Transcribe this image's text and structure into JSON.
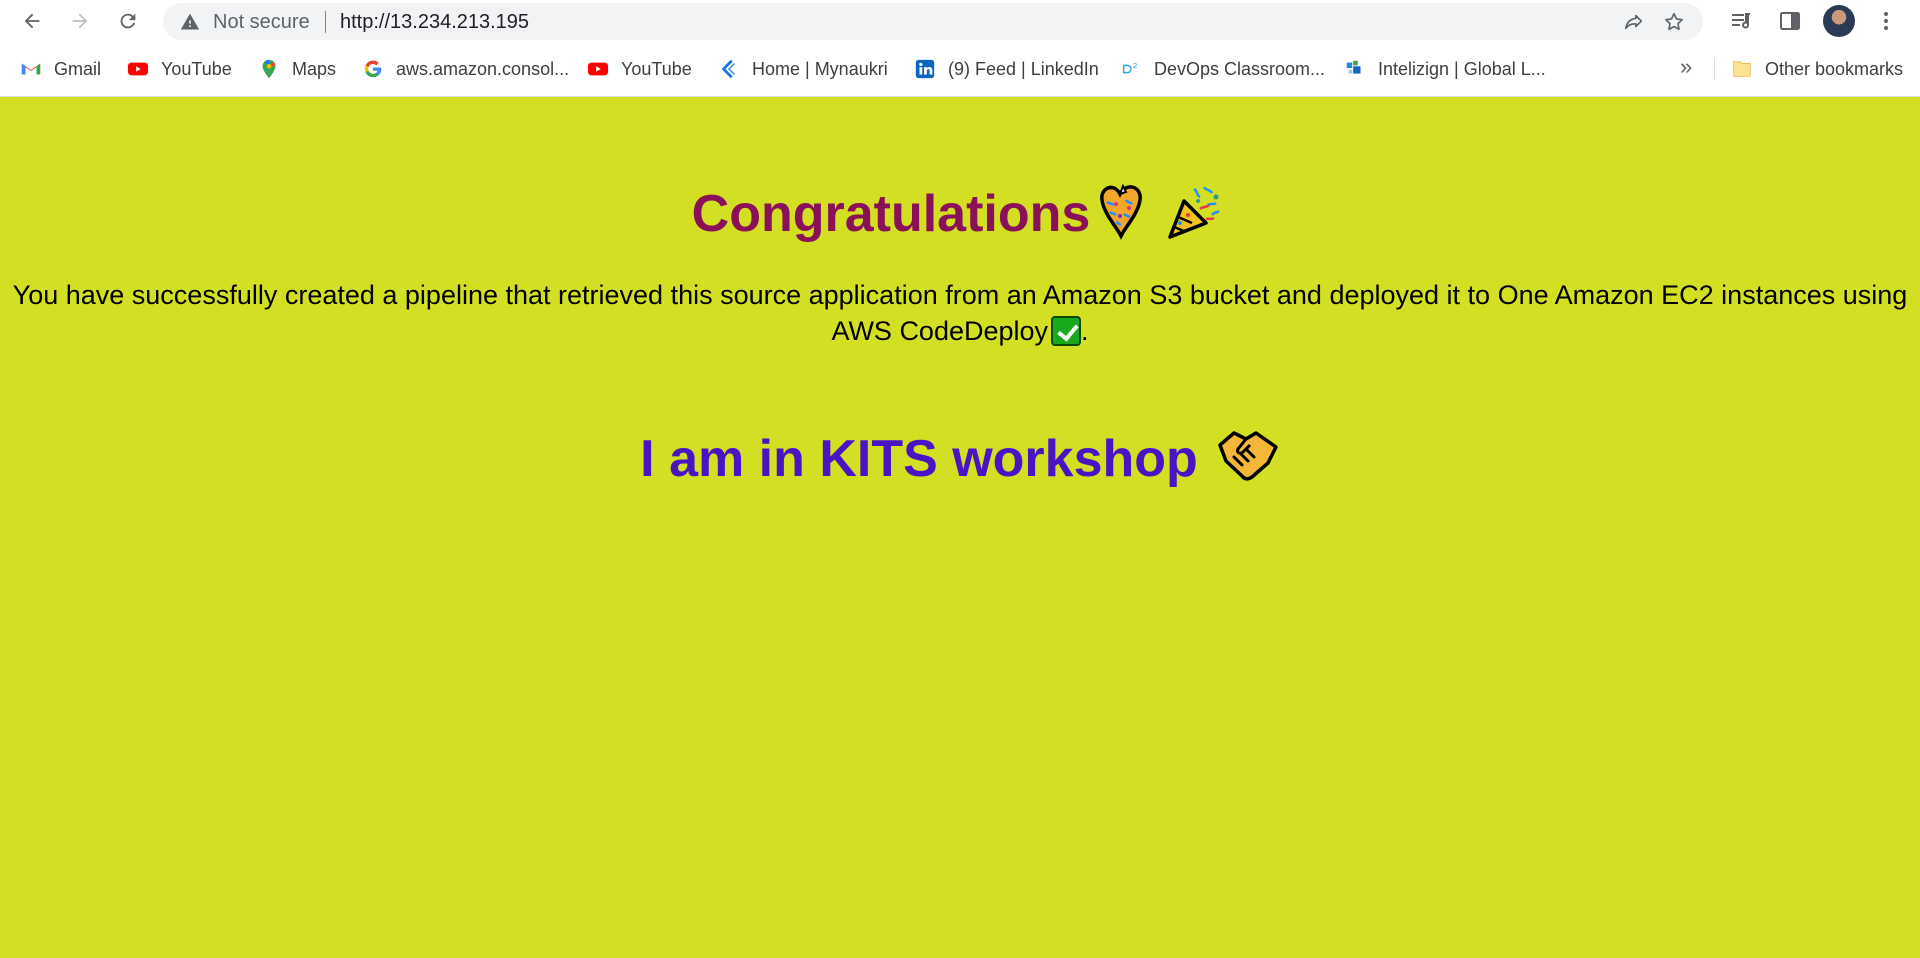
{
  "browser": {
    "security_label": "Not secure",
    "url": "http://13.234.213.195"
  },
  "bookmarks": [
    {
      "label": "Gmail",
      "icon": "gmail-icon"
    },
    {
      "label": "YouTube",
      "icon": "youtube-icon"
    },
    {
      "label": "Maps",
      "icon": "maps-icon"
    },
    {
      "label": "aws.amazon.consol...",
      "icon": "google-icon"
    },
    {
      "label": "YouTube",
      "icon": "youtube-icon"
    },
    {
      "label": "Home | Mynaukri",
      "icon": "mynaukri-icon"
    },
    {
      "label": "(9) Feed | LinkedIn",
      "icon": "linkedin-icon"
    },
    {
      "label": "DevOps Classroom...",
      "icon": "devops-icon"
    },
    {
      "label": "Intelizign | Global L...",
      "icon": "intelizign-icon"
    }
  ],
  "other_bookmarks": "Other bookmarks",
  "overflow": "»",
  "content": {
    "heading": "Congratulations",
    "paragraph_main": "You have successfully created a pipeline that retrieved this source application from an Amazon S3 bucket and deployed it to One Amazon EC2 instances using AWS CodeDeploy",
    "paragraph_end": ".",
    "subheading": "I am in KITS workshop"
  },
  "colors": {
    "background": "#d3df22",
    "heading": "#8a1159",
    "subheading": "#4a14c4"
  }
}
